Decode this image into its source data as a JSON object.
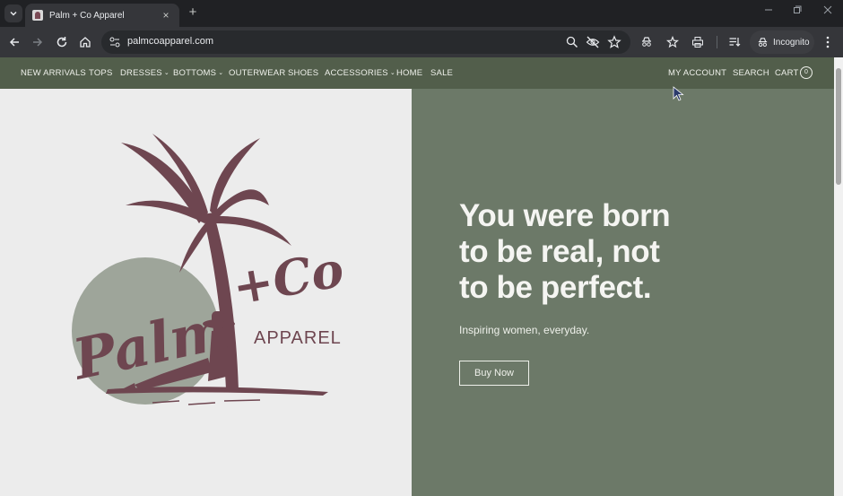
{
  "browser": {
    "tab": {
      "title": "Palm + Co Apparel"
    },
    "new_tab_symbol": "+",
    "close_symbol": "×",
    "address": "palmcoapparel.com",
    "incognito_label": "Incognito"
  },
  "nav": {
    "items": [
      {
        "label": "NEW ARRIVALS"
      },
      {
        "label": "TOPS"
      },
      {
        "label": "DRESSES",
        "dropdown": true
      },
      {
        "label": "BOTTOMS",
        "dropdown": true
      },
      {
        "label": "OUTERWEAR"
      },
      {
        "label": "SHOES"
      },
      {
        "label": "ACCESSORIES",
        "dropdown": true
      },
      {
        "label": "HOME"
      },
      {
        "label": "SALE"
      }
    ],
    "right": {
      "account": "MY ACCOUNT",
      "search": "SEARCH",
      "cart": "CART",
      "cart_count": "0"
    }
  },
  "logo": {
    "script_text": "Palm",
    "plus_co_text": "+Co",
    "apparel_text": "APPAREL"
  },
  "hero": {
    "headline_lines": [
      "You were born",
      "to be real, not",
      "to be perfect."
    ],
    "subline": "Inspiring women, everyday.",
    "cta": "Buy Now"
  },
  "colors": {
    "nav_bg": "#525e4b",
    "hero_right_bg": "#6c7968",
    "hero_left_bg": "#ececec",
    "logo_maroon": "#6e4650",
    "logo_circle": "#9ea59a"
  },
  "icons": [
    "tab-list-icon",
    "close-icon",
    "plus-icon",
    "minimize-icon",
    "restore-icon",
    "window-close-icon",
    "back-icon",
    "forward-icon",
    "reload-icon",
    "home-icon",
    "site-settings-icon",
    "zoom-icon",
    "tracking-eye-off-icon",
    "star-icon",
    "incognito-icon",
    "bookmarks-icon",
    "print-icon",
    "reading-list-icon",
    "kebab-menu-icon",
    "cart-icon",
    "cursor-icon"
  ]
}
